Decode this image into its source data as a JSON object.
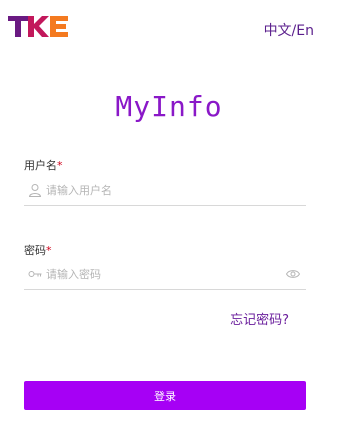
{
  "header": {
    "logo_text": "TKE",
    "language_toggle": "中文/En",
    "colors": {
      "logo_t": "#6a1a82",
      "logo_k": "#c2185b",
      "logo_e": "#f47a20"
    }
  },
  "app": {
    "title": "MyInfo"
  },
  "form": {
    "username": {
      "label": "用户名",
      "required_mark": "*",
      "placeholder": "请输入用户名",
      "icon": "user-icon"
    },
    "password": {
      "label": "密码",
      "required_mark": "*",
      "placeholder": "请输入密码",
      "icon": "key-icon",
      "toggle_icon": "eye-icon"
    },
    "forgot_label": "忘记密码?",
    "submit_label": "登录"
  },
  "theme": {
    "accent": "#a600f5",
    "title_color": "#8a18c8",
    "link_color": "#6a1e9c"
  }
}
